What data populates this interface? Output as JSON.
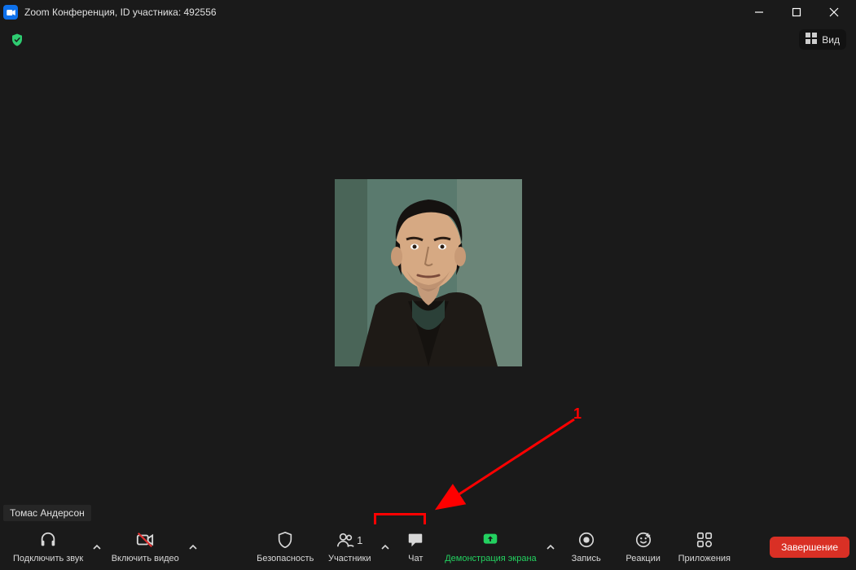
{
  "titlebar": {
    "title": "Zoom Конференция, ID участника: 492556"
  },
  "view": {
    "label": "Вид"
  },
  "participant": {
    "name": "Томас Андерсон"
  },
  "toolbar": {
    "audio_label": "Подключить звук",
    "video_label": "Включить видео",
    "security_label": "Безопасность",
    "participants_label": "Участники",
    "participants_count": "1",
    "chat_label": "Чат",
    "share_label": "Демонстрация экрана",
    "record_label": "Запись",
    "reactions_label": "Реакции",
    "apps_label": "Приложения",
    "end_label": "Завершение"
  },
  "annotation": {
    "number": "1"
  }
}
